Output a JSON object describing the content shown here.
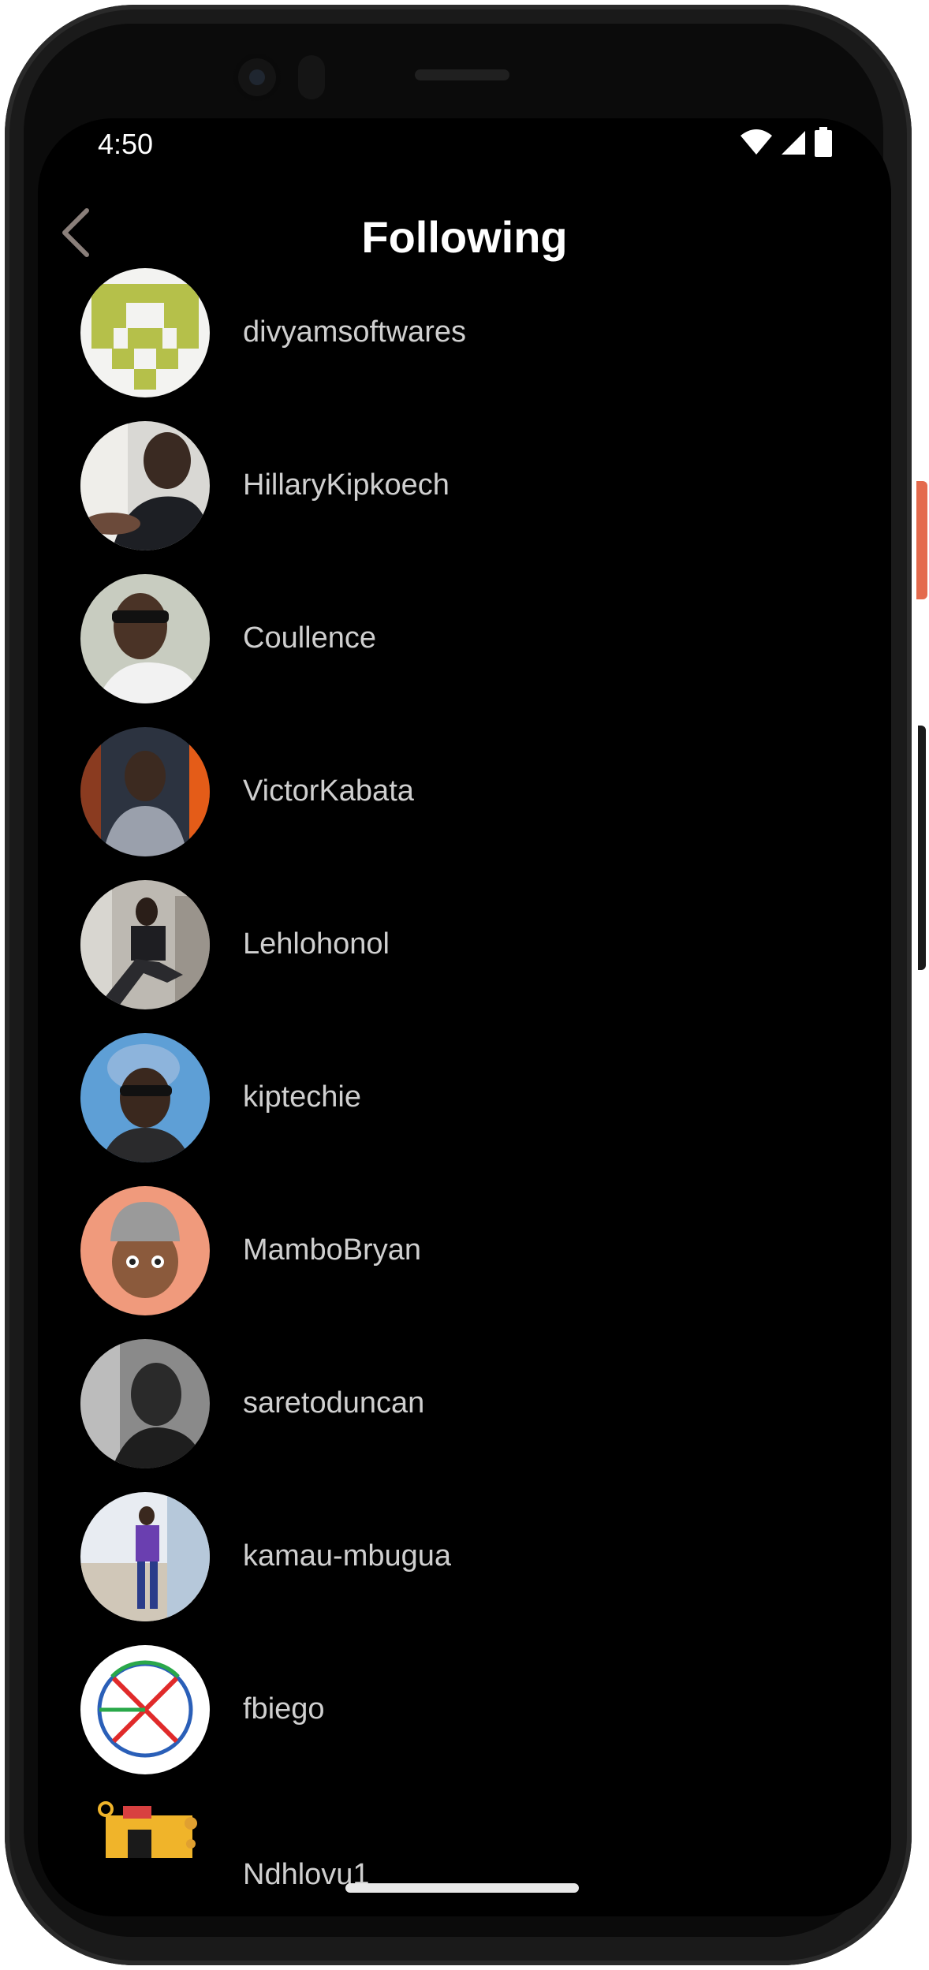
{
  "status_bar": {
    "time": "4:50"
  },
  "header": {
    "title": "Following"
  },
  "following": [
    {
      "username": "divyamsoftwares"
    },
    {
      "username": "HillaryKipkoech"
    },
    {
      "username": "Coullence"
    },
    {
      "username": "VictorKabata"
    },
    {
      "username": "Lehlohonol"
    },
    {
      "username": "kiptechie"
    },
    {
      "username": "MamboBryan"
    },
    {
      "username": "saretoduncan"
    },
    {
      "username": "kamau-mbugua"
    },
    {
      "username": "fbiego"
    },
    {
      "username": "Ndhlovu1"
    }
  ],
  "colors": {
    "background": "#000000",
    "title": "#ffffff",
    "username": "#cfcfcf",
    "accent_orange": "#e46a4d"
  }
}
